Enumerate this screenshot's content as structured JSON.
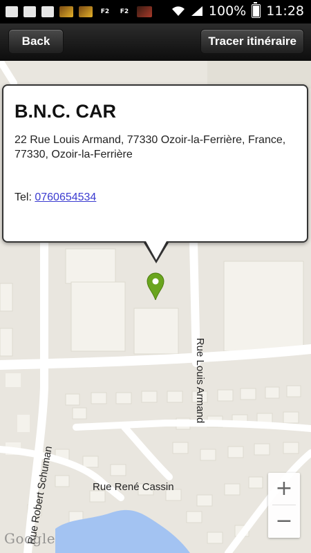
{
  "status_bar": {
    "battery_percent": "100%",
    "time": "11:28",
    "notification_icons": [
      "message-icon",
      "mail-icon",
      "image-icon",
      "app-icon",
      "app-icon",
      "F2",
      "F2",
      "app-icon"
    ]
  },
  "action_bar": {
    "back_label": "Back",
    "route_label": "Tracer itinéraire"
  },
  "map": {
    "streets": {
      "rue_louis_armand": "Rue Louis Armand",
      "rue_rene_cassin": "Rue René Cassin",
      "rue_robert_schuman": "Rue Robert Schuman"
    },
    "zoom_in_label": "+",
    "zoom_out_label": "−",
    "attribution": "Google"
  },
  "popup": {
    "title": "B.N.C. CAR",
    "address": "22 Rue Louis Armand, 77330 Ozoir-la-Ferrière, France, 77330, Ozoir-la-Ferrière",
    "tel_label": "Tel: ",
    "tel_number": "0760654534"
  },
  "colors": {
    "pin": "#6aa51e",
    "link": "#3a3ad0",
    "water": "#a3c3f2"
  }
}
